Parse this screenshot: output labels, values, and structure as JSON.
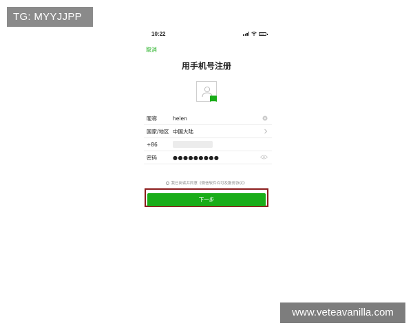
{
  "overlay": {
    "tg_label": "TG: MYYJJPP",
    "watermark": "www.veteavanilla.com"
  },
  "status_bar": {
    "time": "10:22"
  },
  "nav": {
    "cancel_label": "取消",
    "title": "用手机号注册"
  },
  "form": {
    "nickname_label": "昵称",
    "nickname_value": "helen",
    "region_label": "国家/地区",
    "region_value": "中国大陆",
    "country_code": "+86",
    "password_label": "密码",
    "password_value": "●●●●●●●●●"
  },
  "agreement": {
    "text": "我已阅读并同意《微信软件许可及服务协议》"
  },
  "next_button": {
    "label": "下一步"
  },
  "colors": {
    "accent": "#1aad19",
    "highlight_border": "#8b1c1c"
  },
  "icons": {
    "avatar_placeholder": "person-icon",
    "avatar_badge": "camera-icon",
    "clear": "clear-icon",
    "chevron": "chevron-right-icon",
    "password_toggle": "eye-icon"
  }
}
